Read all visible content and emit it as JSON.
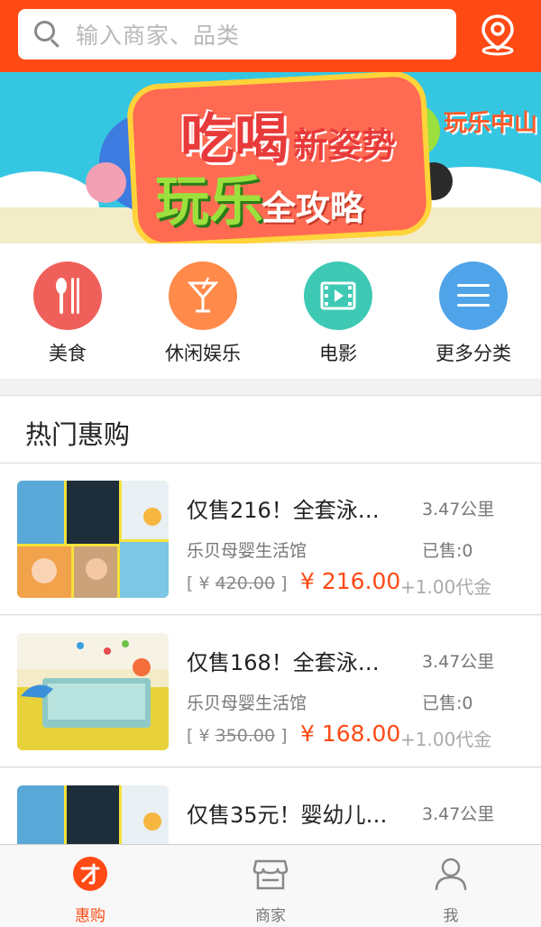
{
  "search": {
    "placeholder": "输入商家、品类"
  },
  "banner": {
    "line1": "吃喝",
    "line2": "新姿势",
    "line3": "玩乐",
    "line4": "全攻略",
    "logo": "玩乐中山"
  },
  "categories": [
    {
      "label": "美食",
      "icon": "fork-knife-icon",
      "color": "#f0605a"
    },
    {
      "label": "休闲娱乐",
      "icon": "cocktail-icon",
      "color": "#ff8a4a"
    },
    {
      "label": "电影",
      "icon": "film-icon",
      "color": "#3ec9b4"
    },
    {
      "label": "更多分类",
      "icon": "menu-icon",
      "color": "#4fa3e8"
    }
  ],
  "hot_section": {
    "title": "热门惠购"
  },
  "deals": [
    {
      "title": "仅售216！全套泳…",
      "distance": "3.47公里",
      "shop": "乐贝母婴生活馆",
      "sold": "已售:0",
      "orig_prefix": "[ ¥ ",
      "orig_price": "420.00",
      "orig_suffix": " ]",
      "price": "¥ 216.00",
      "extra": "+1.00代金"
    },
    {
      "title": "仅售168！全套泳…",
      "distance": "3.47公里",
      "shop": "乐贝母婴生活馆",
      "sold": "已售:0",
      "orig_prefix": "[ ¥ ",
      "orig_price": "350.00",
      "orig_suffix": " ]",
      "price": "¥ 168.00",
      "extra": "+1.00代金"
    },
    {
      "title": "仅售35元！婴幼儿…",
      "distance": "3.47公里"
    }
  ],
  "tabs": [
    {
      "label": "惠购",
      "icon": "deal-icon",
      "active": true
    },
    {
      "label": "商家",
      "icon": "store-icon",
      "active": false
    },
    {
      "label": "我",
      "icon": "user-icon",
      "active": false
    }
  ],
  "colors": {
    "accent": "#ff4a14",
    "tab_active": "#ff4a14"
  }
}
